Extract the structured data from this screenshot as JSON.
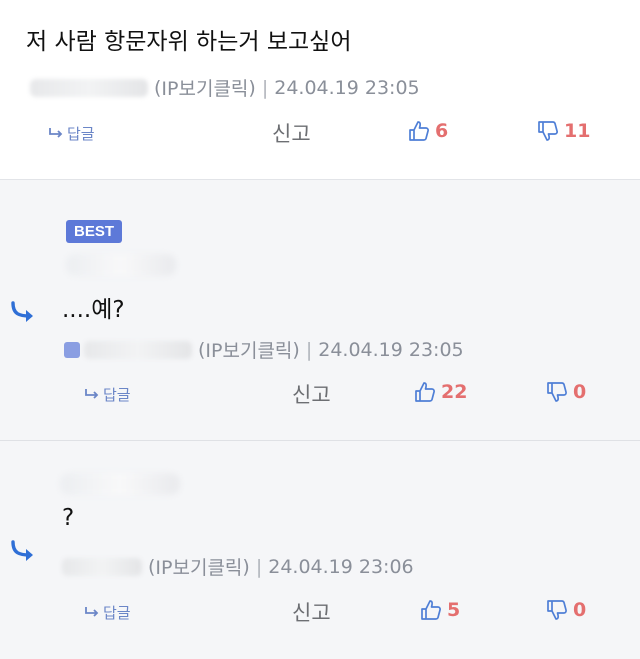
{
  "comments": [
    {
      "text": "저 사람 항문자위 하는거 보고싶어",
      "ip_label": "IP보기클릭",
      "ip_paren_open": "(",
      "ip_paren_close": ")",
      "separator": "|",
      "timestamp": "24.04.19 23:05",
      "reply_label": "답글",
      "report_label": "신고",
      "upvotes": "6",
      "downvotes": "11"
    },
    {
      "badge": "BEST",
      "text": "....예?",
      "ip_label": "IP보기클릭",
      "ip_paren_open": "(",
      "ip_paren_close": ")",
      "separator": "|",
      "timestamp": "24.04.19 23:05",
      "reply_label": "답글",
      "report_label": "신고",
      "upvotes": "22",
      "downvotes": "0"
    },
    {
      "text": "?",
      "ip_label": "IP보기클릭",
      "ip_paren_open": "(",
      "ip_paren_close": ")",
      "separator": "|",
      "timestamp": "24.04.19 23:06",
      "reply_label": "답글",
      "report_label": "신고",
      "upvotes": "5",
      "downvotes": "0"
    }
  ],
  "colors": {
    "accent_blue": "#5d79d8",
    "vote_red": "#e46f6f",
    "meta_gray": "#8a8f99",
    "reply_blue": "#2f6fd6"
  },
  "icons": {
    "reply": "reply-arrow-icon",
    "thumbs_up": "thumbs-up-icon",
    "thumbs_down": "thumbs-down-icon",
    "reply_indicator": "curved-reply-arrow-icon"
  }
}
